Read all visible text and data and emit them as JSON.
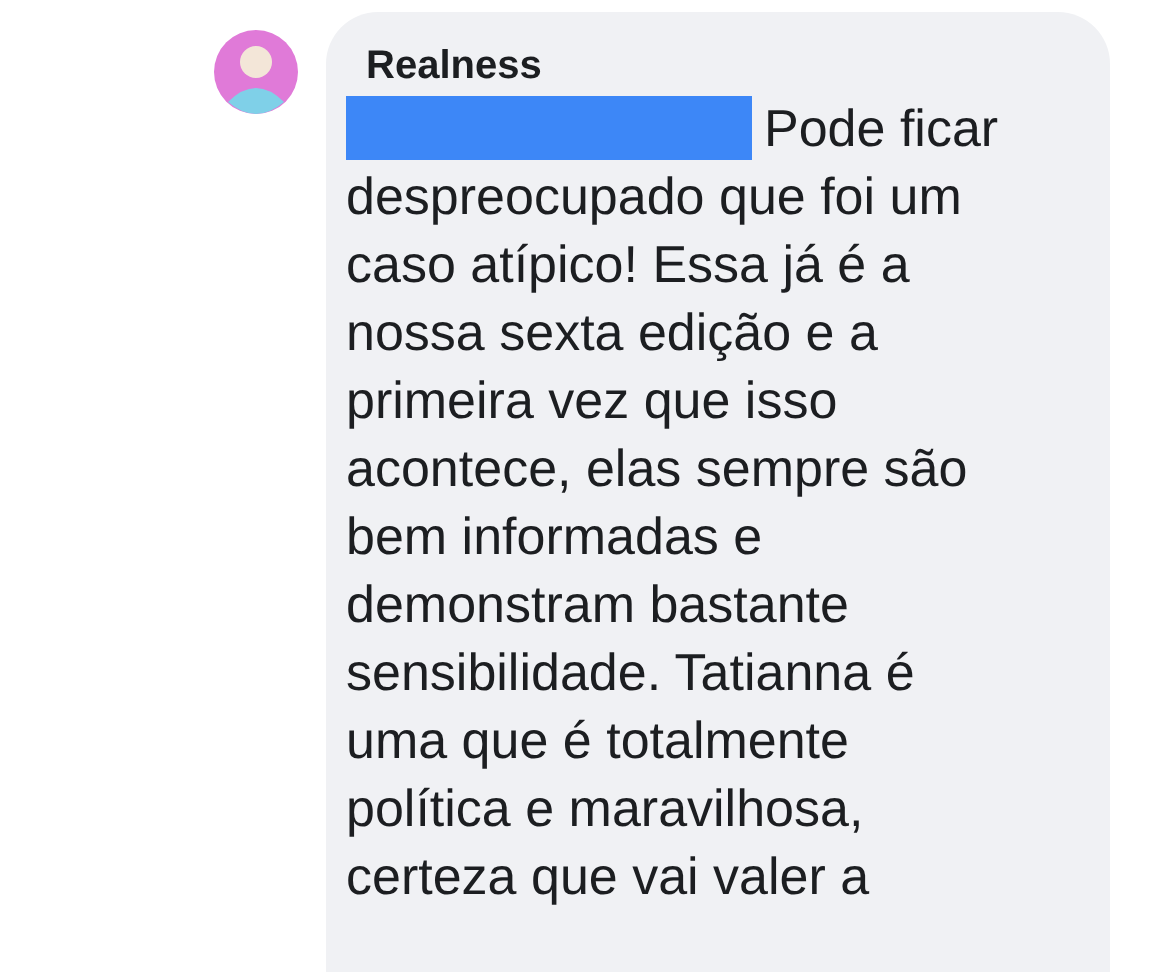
{
  "comment": {
    "author": "Realness",
    "mention_redacted": true,
    "lines": [
      "Pode ficar",
      "despreocupado que foi um",
      "caso atípico! Essa já é a",
      "nossa sexta edição e a",
      "primeira vez que isso",
      "acontece, elas sempre são",
      "bem informadas e",
      "demonstram bastante",
      "sensibilidade. Tatianna é",
      "uma que é totalmente",
      "política e maravilhosa,",
      "certeza que vai valer a"
    ]
  }
}
